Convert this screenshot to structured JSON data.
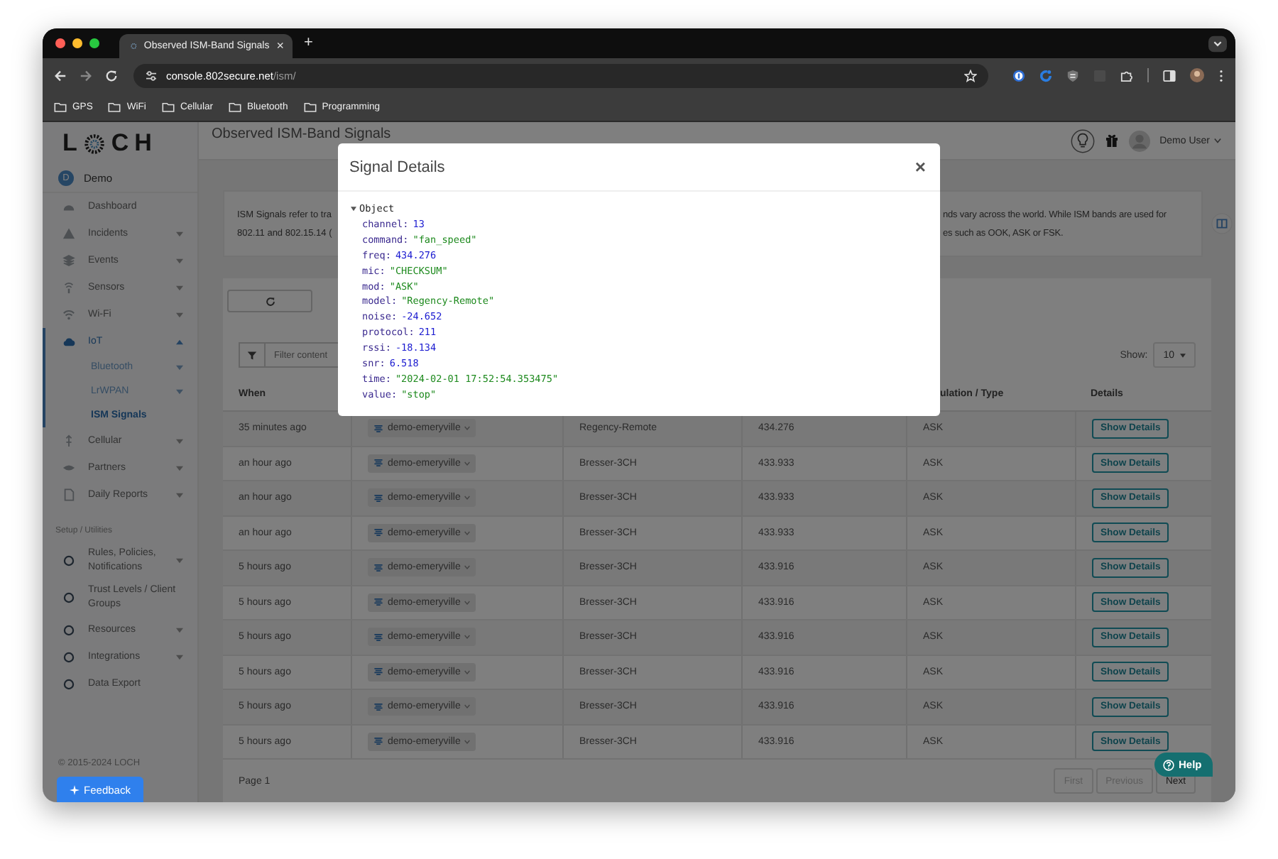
{
  "browser": {
    "tab_title": "Observed ISM-Band Signals",
    "tab_close": "×",
    "new_tab": "+",
    "url_domain": "console.802secure.net",
    "url_path": "/ism/",
    "bookmarks": [
      "GPS",
      "WiFi",
      "Cellular",
      "Bluetooth",
      "Programming"
    ]
  },
  "sidebar": {
    "logo_start": "L",
    "logo_end": "CH",
    "account": {
      "initial": "D",
      "name": "Demo"
    },
    "items": [
      {
        "label": "Dashboard",
        "selected": false
      },
      {
        "label": "Incidents",
        "expanded": false,
        "selected": false
      },
      {
        "label": "Events",
        "expanded": false,
        "selected": false
      },
      {
        "label": "Sensors",
        "expanded": false,
        "selected": false
      },
      {
        "label": "Wi-Fi",
        "expanded": false,
        "selected": false
      },
      {
        "label": "IoT",
        "expanded": true,
        "selected": true,
        "children": [
          {
            "label": "Bluetooth",
            "expanded": false,
            "selected": false
          },
          {
            "label": "LrWPAN",
            "expanded": false,
            "selected": false
          },
          {
            "label": "ISM Signals",
            "selected": true
          }
        ]
      },
      {
        "label": "Cellular",
        "expanded": false,
        "selected": false
      },
      {
        "label": "Partners",
        "expanded": false,
        "selected": false
      },
      {
        "label": "Daily Reports",
        "expanded": false,
        "selected": false
      }
    ],
    "section": "Setup / Utilities",
    "setup_items": [
      {
        "label": "Rules, Policies, Notifications",
        "expanded": false,
        "selected": false
      },
      {
        "label": "Trust Levels / Client Groups",
        "selected": false
      },
      {
        "label": "Resources",
        "expanded": false,
        "selected": false
      },
      {
        "label": "Integrations",
        "expanded": false,
        "selected": false
      },
      {
        "label": "Data Export",
        "selected": false
      }
    ],
    "copyright": "© 2015-2024 LOCH"
  },
  "feedback": "Feedback",
  "header": {
    "title": "Observed ISM-Band Signals",
    "user": "Demo User"
  },
  "info": {
    "left_lines": [
      "ISM Signals refer to tra",
      "802.11 and 802.15.14 ("
    ],
    "right_lines": [
      "nds vary across the world. While ISM bands are used for",
      "es such as OOK, ASK or FSK."
    ]
  },
  "table": {
    "filter_placeholder": "Filter content",
    "show_label": "Show:",
    "page_size": "10",
    "columns": {
      "column_1": "When",
      "column_5": "ulation / Type",
      "column_6": "Details"
    },
    "rows": [
      {
        "when": "35 minutes ago",
        "column_2": "demo-emeryville",
        "column_3": "Regency-Remote",
        "column_4": "434.276",
        "column_5": "ASK",
        "action": "Show Details"
      },
      {
        "when": "an hour ago",
        "column_2": "demo-emeryville",
        "column_3": "Bresser-3CH",
        "column_4": "433.933",
        "column_5": "ASK",
        "action": "Show Details"
      },
      {
        "when": "an hour ago",
        "column_2": "demo-emeryville",
        "column_3": "Bresser-3CH",
        "column_4": "433.933",
        "column_5": "ASK",
        "action": "Show Details"
      },
      {
        "when": "an hour ago",
        "column_2": "demo-emeryville",
        "column_3": "Bresser-3CH",
        "column_4": "433.933",
        "column_5": "ASK",
        "action": "Show Details"
      },
      {
        "when": "5 hours ago",
        "column_2": "demo-emeryville",
        "column_3": "Bresser-3CH",
        "column_4": "433.916",
        "column_5": "ASK",
        "action": "Show Details"
      },
      {
        "when": "5 hours ago",
        "column_2": "demo-emeryville",
        "column_3": "Bresser-3CH",
        "column_4": "433.916",
        "column_5": "ASK",
        "action": "Show Details"
      },
      {
        "when": "5 hours ago",
        "column_2": "demo-emeryville",
        "column_3": "Bresser-3CH",
        "column_4": "433.916",
        "column_5": "ASK",
        "action": "Show Details"
      },
      {
        "when": "5 hours ago",
        "column_2": "demo-emeryville",
        "column_3": "Bresser-3CH",
        "column_4": "433.916",
        "column_5": "ASK",
        "action": "Show Details"
      },
      {
        "when": "5 hours ago",
        "column_2": "demo-emeryville",
        "column_3": "Bresser-3CH",
        "column_4": "433.916",
        "column_5": "ASK",
        "action": "Show Details"
      },
      {
        "when": "5 hours ago",
        "column_2": "demo-emeryville",
        "column_3": "Bresser-3CH",
        "column_4": "433.916",
        "column_5": "ASK",
        "action": "Show Details"
      }
    ]
  },
  "pagination": {
    "page": "Page 1",
    "buttons": [
      {
        "label": "First",
        "disabled": true
      },
      {
        "label": "Previous",
        "disabled": true
      },
      {
        "label": "Next",
        "disabled": false
      }
    ]
  },
  "help": "Help",
  "modal": {
    "title": "Signal Details",
    "close": "×",
    "root": {
      "label": "Object",
      "expanded": true,
      "props": [
        {
          "key": "channel:",
          "value": "13",
          "kind": "number"
        },
        {
          "key": "command:",
          "value": "\"fan_speed\"",
          "kind": "string"
        },
        {
          "key": "freq:",
          "value": "434.276",
          "kind": "number"
        },
        {
          "key": "mic:",
          "value": "\"CHECKSUM\"",
          "kind": "string"
        },
        {
          "key": "mod:",
          "value": "\"ASK\"",
          "kind": "string"
        },
        {
          "key": "model:",
          "value": "\"Regency-Remote\"",
          "kind": "string"
        },
        {
          "key": "noise:",
          "value": "-24.652",
          "kind": "number"
        },
        {
          "key": "protocol:",
          "value": "211",
          "kind": "number"
        },
        {
          "key": "rssi:",
          "value": "-18.134",
          "kind": "number"
        },
        {
          "key": "snr:",
          "value": "6.518",
          "kind": "number"
        },
        {
          "key": "time:",
          "value": "\"2024-02-01 17:52:54.353475\"",
          "kind": "string"
        },
        {
          "key": "value:",
          "value": "\"stop\"",
          "kind": "string"
        }
      ]
    }
  }
}
